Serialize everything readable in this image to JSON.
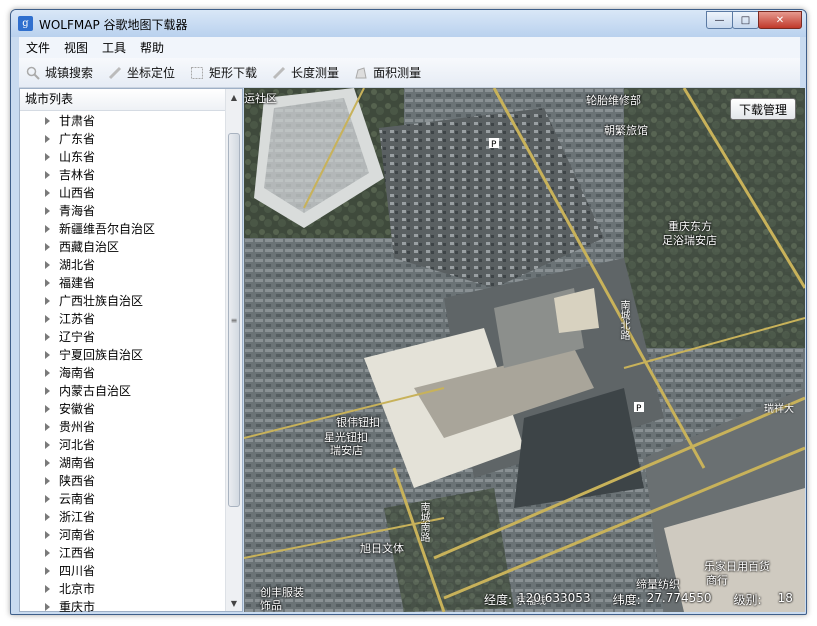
{
  "window": {
    "title": "WOLFMAP 谷歌地图下载器",
    "app_icon": "g"
  },
  "menu": [
    "文件",
    "视图",
    "工具",
    "帮助"
  ],
  "toolbar": [
    {
      "label": "城镇搜索",
      "icon": "search-icon"
    },
    {
      "label": "坐标定位",
      "icon": "pencil-icon"
    },
    {
      "label": "矩形下载",
      "icon": "rectangle-icon"
    },
    {
      "label": "长度测量",
      "icon": "ruler-icon"
    },
    {
      "label": "面积测量",
      "icon": "area-icon"
    }
  ],
  "sidebar": {
    "header": "城市列表",
    "items": [
      "甘肃省",
      "广东省",
      "山东省",
      "吉林省",
      "山西省",
      "青海省",
      "新疆维吾尔自治区",
      "西藏自治区",
      "湖北省",
      "福建省",
      "广西壮族自治区",
      "江苏省",
      "辽宁省",
      "宁夏回族自治区",
      "海南省",
      "内蒙古自治区",
      "安徽省",
      "贵州省",
      "河北省",
      "湖南省",
      "陕西省",
      "云南省",
      "浙江省",
      "河南省",
      "江西省",
      "四川省",
      "北京市",
      "重庆市"
    ]
  },
  "map": {
    "download_button": "下载管理",
    "pois": [
      {
        "label": "轮胎维修部"
      },
      {
        "label": "朝繁旅馆"
      },
      {
        "label": "重庆东方"
      },
      {
        "label": "足浴瑞安店"
      },
      {
        "label": "银伟钮扣"
      },
      {
        "label": "星光钮扣"
      },
      {
        "label": "瑞安店"
      },
      {
        "label": "旭日文体"
      },
      {
        "label": "乐家日用百货"
      },
      {
        "label": "商行"
      },
      {
        "label": "缔量纺织"
      },
      {
        "label": "创丰服装"
      },
      {
        "label": "饰品"
      },
      {
        "label": "运社区"
      }
    ],
    "roads": {
      "north": "南城北路",
      "south": "南城南路",
      "east": "瑞祥大",
      "bottom": "京福线"
    },
    "parking": "P",
    "status": {
      "lng_label": "经度:",
      "lng": "120.633053",
      "lat_label": "纬度:",
      "lat": "27.774550",
      "zoom_label": "级别:",
      "zoom": "18"
    }
  }
}
